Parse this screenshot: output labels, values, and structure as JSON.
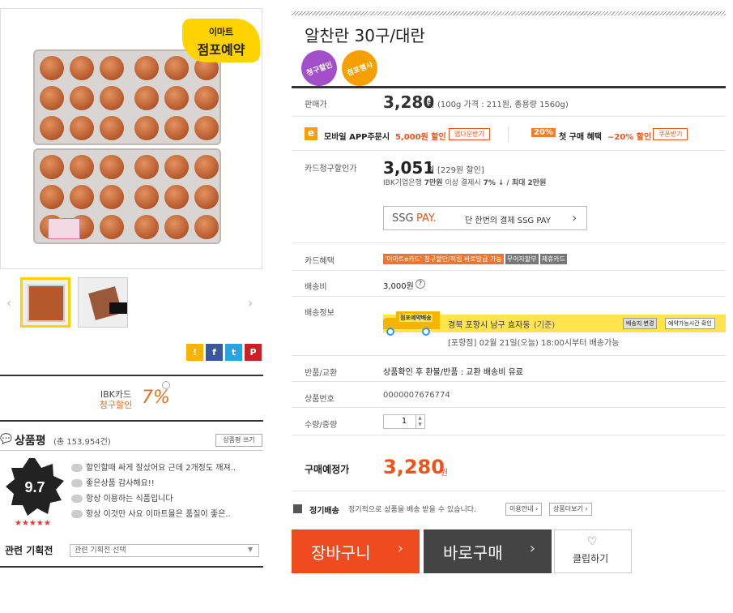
{
  "left": {
    "badge": {
      "line1": "이마트",
      "line2": "점포예약"
    },
    "image_label": "IBK카드",
    "thumbs_prev": "‹",
    "thumbs_next": "›",
    "share_icons": [
      "bookmark-icon",
      "facebook-icon",
      "twitter-icon",
      "pinterest-icon"
    ],
    "ibk": {
      "line1": "IBK카드",
      "line2": "청구할인",
      "percent": "7%"
    },
    "review": {
      "title": "상품평",
      "count": "(총 153,954건)",
      "write_btn": "상품평 쓰기",
      "score": "9.7",
      "stars": "★★★★★",
      "items": [
        "할인할때 싸게 잘샀어요 근데 2개정도 깨져..",
        "좋은상품 감사해요!!",
        "항상 이용하는 식품입니다",
        "항상 이것만 사요 이마트몰은 품질이 좋은.."
      ]
    },
    "related": {
      "label": "관련 기획전",
      "placeholder": "관련 기획전 선택"
    }
  },
  "right": {
    "title": "알찬란 30구/대란",
    "badges": [
      {
        "label": "청구할인",
        "color": "#a24fc9"
      },
      {
        "label": "점포행사",
        "color": "#f5a000"
      }
    ],
    "sale": {
      "label": "판매가",
      "price": "3,280",
      "unit": "원",
      "note": "(100g 가격 : 211원, 총용량 1560g)"
    },
    "app": {
      "icon_text": "e",
      "text": "모바일 APP주문시",
      "discount": "5,000원 할인",
      "btn": "앱다운받기"
    },
    "first": {
      "pct": "20%",
      "text": "첫 구매 혜택",
      "discount": "~20% 할인",
      "btn": "쿠폰받기"
    },
    "card": {
      "label": "카드청구할인가",
      "price": "3,051",
      "unit": "원",
      "note": "[229원 할인]",
      "desc1": "IBK기업은행",
      "desc2": "7만원",
      "desc3": "이상 결제시",
      "desc4": "7%",
      "desc5": "↓ / 최대 2만원"
    },
    "ssg": {
      "logo_a": "SSG",
      "logo_b": "PAY.",
      "text": "단 한번의 결제 SSG PAY",
      "arrow": "›"
    },
    "benefit": {
      "label": "카드혜택",
      "tags": [
        {
          "text": "'이마트e카드' 청구할인/적립 바로발급 가능",
          "color": "#f0752a"
        },
        {
          "text": "무이자할부",
          "color": "#777"
        },
        {
          "text": "제휴카드",
          "color": "#777"
        }
      ]
    },
    "fee": {
      "label": "배송비",
      "value": "3,000원",
      "help": "?"
    },
    "shipinfo": {
      "label": "배송정보",
      "truck_label": "점포예약배송",
      "address": "경북 포항시 남구 효자동",
      "base": "(기준)",
      "btn1": "배송지 변경",
      "btn2": "예약가능시간 확인",
      "store": "[포항점] 02월 21일(오늘) 18:00시부터 배송가능"
    },
    "exchange": {
      "label": "반품/교환",
      "value": "상품확인 후 환불/반품 : 교환 배송비 유료"
    },
    "product_no": {
      "label": "상품번호",
      "value": "0000007676774"
    },
    "qty": {
      "label": "수량/중량",
      "value": "1"
    },
    "total": {
      "label": "구매예정가",
      "price": "3,280",
      "unit": "원"
    },
    "regular": {
      "label": "정기배송",
      "text": "정기적으로 상품을 배송 받을 수 있습니다.",
      "btn1": "이용안내 ›",
      "btn2": "상품더보기 ›"
    },
    "buttons": {
      "cart": "장바구니",
      "buy": "바로구매",
      "clip": "클립하기",
      "arrow": "›"
    }
  }
}
